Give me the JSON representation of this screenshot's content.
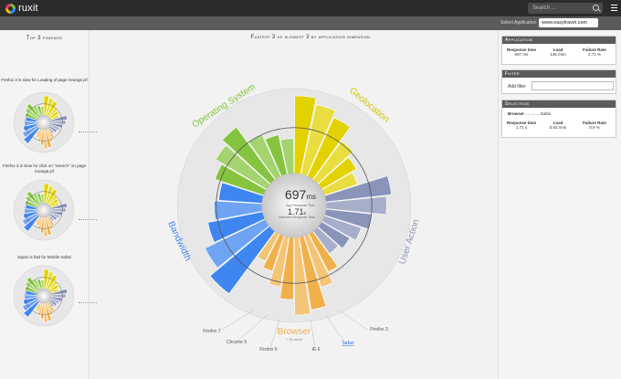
{
  "topbar": {
    "logo": "ruxit",
    "search_placeholder": "Search ..."
  },
  "appbar": {
    "label": "Select Application",
    "selected": "www.easytravel.com"
  },
  "left": {
    "heading": "Top 3 findings",
    "findings": [
      "Firefox 3 is slow for Loading of page /orange.jsf",
      "Firefox 3 is slow for click on \"Search\" on page /orange.jsf",
      "Japan is fast for Mobile Safari"
    ]
  },
  "center": {
    "title": "Fastest 3 vs slowest 3 by application dimension",
    "main_value": "697",
    "main_unit": "ms",
    "main_label": "App Response Time",
    "sub_value": "1.71",
    "sub_unit": "s",
    "sub_label": "Selection Response Time",
    "segments": {
      "os": "Operating System",
      "geo": "Geolocation",
      "user": "User Action",
      "browser": "Browser",
      "bandwidth": "Bandwidth"
    },
    "browser_more": "+ 31 more",
    "browser_labels": [
      "Firefox 7",
      "Chrome 9",
      "Firefox 6",
      "IE 6",
      "Safari",
      "Firefox 3"
    ],
    "colors": {
      "os": "#86c440",
      "geo": "#e2d200",
      "user": "#8a93b8",
      "browser": "#f0b04a",
      "bandwidth": "#3f86f0"
    }
  },
  "right": {
    "application": {
      "title": "Application",
      "cols": [
        {
          "label": "Response time",
          "value": "697 ms"
        },
        {
          "label": "Load",
          "value": "146 /min"
        },
        {
          "label": "Failure Rate",
          "value": "2.71 %"
        }
      ]
    },
    "filter": {
      "title": "Filter",
      "label": "Add filter"
    },
    "selection": {
      "title": "Selection",
      "key": "Browser",
      "value": "Safari",
      "cols": [
        {
          "label": "Response time",
          "value": "1.71 s"
        },
        {
          "label": "Load",
          "value": "0.93 /min"
        },
        {
          "label": "Failure Rate",
          "value": "0.9 %"
        }
      ]
    }
  }
}
